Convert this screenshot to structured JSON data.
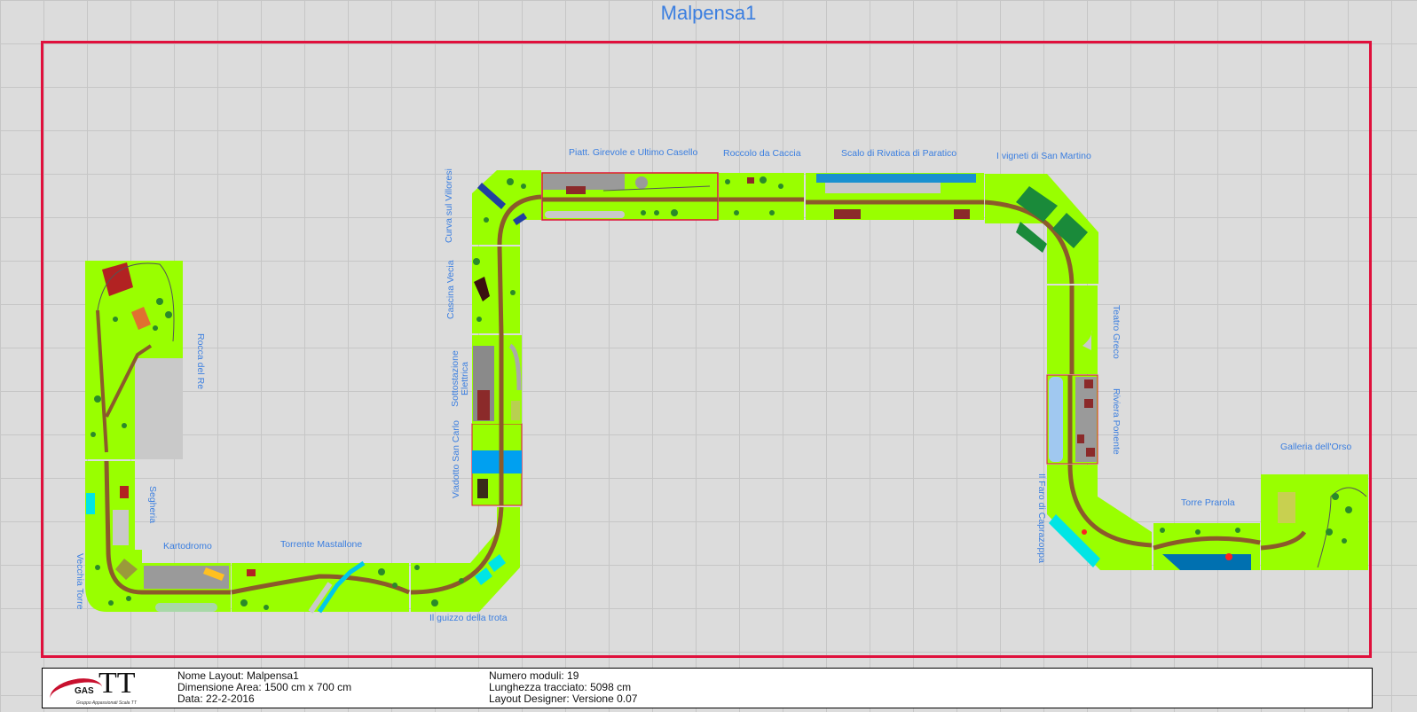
{
  "title": "Malpensa1",
  "colors": {
    "grass": "#99ff00",
    "track": "#8b5a2b",
    "label": "#3a7ee0",
    "frame": "#e0103c"
  },
  "modules": [
    "Rocca del Re",
    "Segheria",
    "Vecchia Torre",
    "Kartodromo",
    "Torrente Mastallone",
    "Il guizzo della trota",
    "Viadotto San Carlo",
    "Sottostazione Elettrica",
    "Cascina Vecia",
    "Curva sul Villoresi",
    "Piatt. Girevole e Ultimo Casello",
    "Roccolo da Caccia",
    "Scalo di Rivatica di Paratico",
    "I vigneti di San Martino",
    "Teatro Greco",
    "Riviera Ponente",
    "Il Faro di Caprazoppa",
    "Torre Prarola",
    "Galleria dell'Orso"
  ],
  "info": {
    "logo_main": "TT",
    "logo_gas": "GAS",
    "logo_sub": "Gruppo Appassionati Scala TT",
    "nome": "Nome Layout: Malpensa1",
    "dimensione": "Dimensione Area: 1500 cm x 700 cm",
    "data": "Data: 22-2-2016",
    "numero": "Numero moduli: 19",
    "lunghezza": "Lunghezza tracciato: 5098 cm",
    "designer": "Layout Designer: Versione 0.07"
  }
}
